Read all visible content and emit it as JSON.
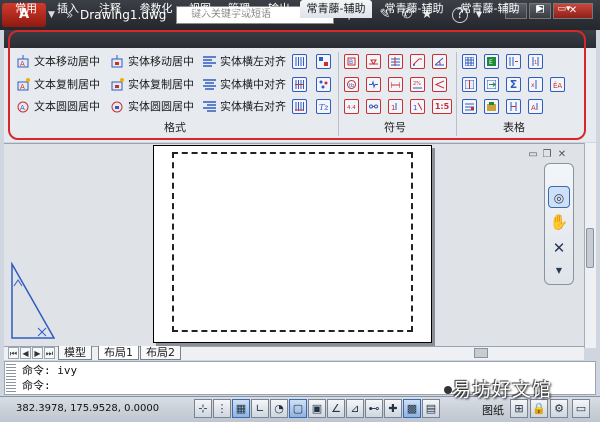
{
  "titlebar": {
    "logo": "A",
    "document_title": "Drawing1.dwg",
    "search_placeholder": "键入关键字或短语"
  },
  "ribbon": {
    "tabs": [
      {
        "label": "常用"
      },
      {
        "label": "插入"
      },
      {
        "label": "注释"
      },
      {
        "label": "参数化"
      },
      {
        "label": "视图"
      },
      {
        "label": "管理"
      },
      {
        "label": "输出"
      },
      {
        "label": "常青藤-辅助",
        "active": true
      },
      {
        "label": "常青藤-辅助"
      },
      {
        "label": "常青藤-辅助"
      }
    ],
    "commands": {
      "col1": [
        "文本移动居中",
        "文本复制居中",
        "文本圆圆居中"
      ],
      "col2": [
        "实体移动居中",
        "实体复制居中",
        "实体圆圆居中"
      ],
      "col3": [
        "实体横左对齐",
        "实体横中对齐",
        "实体横右对齐"
      ]
    },
    "panels": {
      "format": "格式",
      "symbol": "符号",
      "table": "表格"
    },
    "symbol_icon_text": "1:5",
    "table_icon_text": "Σ"
  },
  "layout_tabs": [
    "模型",
    "布局1",
    "布局2"
  ],
  "command_line": {
    "line1": "命令: ivy",
    "line2": "命令:"
  },
  "status": {
    "coordinates": "382.3978, 175.9528, 0.0000",
    "mode_label": "图纸"
  },
  "watermark": "易坊好文馆",
  "colors": {
    "ribbon_highlight": "#d6282a",
    "titlebar": "#2a2d32",
    "accent_blue": "#2f5cc0"
  }
}
